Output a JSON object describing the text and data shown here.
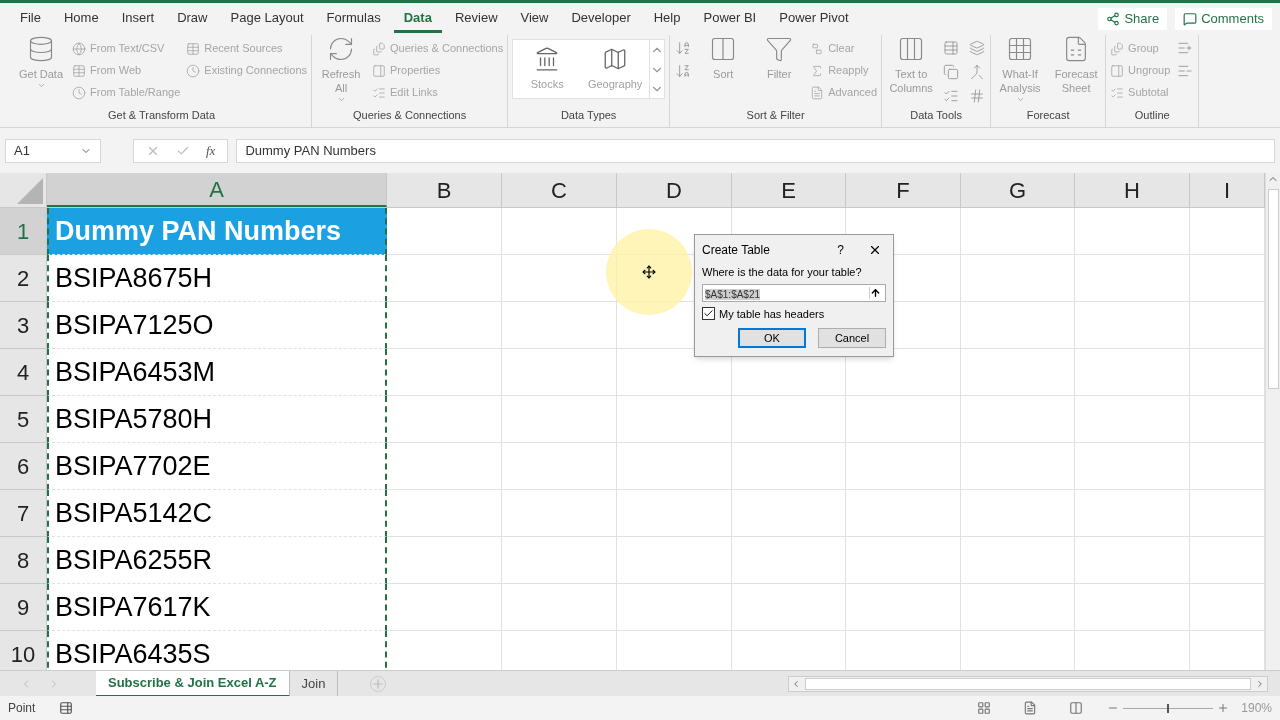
{
  "menu_tabs": [
    {
      "label": "File",
      "selected": false
    },
    {
      "label": "Home",
      "selected": false
    },
    {
      "label": "Insert",
      "selected": false
    },
    {
      "label": "Draw",
      "selected": false
    },
    {
      "label": "Page Layout",
      "selected": false
    },
    {
      "label": "Formulas",
      "selected": false
    },
    {
      "label": "Data",
      "selected": true
    },
    {
      "label": "Review",
      "selected": false
    },
    {
      "label": "View",
      "selected": false
    },
    {
      "label": "Developer",
      "selected": false
    },
    {
      "label": "Help",
      "selected": false
    },
    {
      "label": "Power BI",
      "selected": false
    },
    {
      "label": "Power Pivot",
      "selected": false
    }
  ],
  "share_button": "Share",
  "comments_button": "Comments",
  "ribbon_groups": [
    {
      "label": "Get & Transform Data",
      "items": [
        {
          "kind": "large",
          "label": "Get Data",
          "dropdown": true
        },
        {
          "kind": "stack",
          "labels": [
            "From Text/CSV",
            "From Web",
            "From Table/Range"
          ]
        },
        {
          "kind": "stack",
          "labels": [
            "Recent Sources",
            "Existing Connections"
          ]
        }
      ]
    },
    {
      "label": "Queries & Connections",
      "items": [
        {
          "kind": "large",
          "label": "Refresh All",
          "dropdown": true
        },
        {
          "kind": "stack",
          "labels": [
            "Queries & Connections",
            "Properties",
            "Edit Links"
          ]
        }
      ]
    },
    {
      "label": "Data Types",
      "items": [
        {
          "kind": "gallery",
          "labels": [
            "Stocks",
            "Geography"
          ]
        }
      ]
    },
    {
      "label": "Sort & Filter",
      "items": [
        {
          "kind": "sort_buttons"
        },
        {
          "kind": "large",
          "label": "Sort",
          "dropdown": false
        },
        {
          "kind": "large",
          "label": "Filter",
          "dropdown": false
        },
        {
          "kind": "stack",
          "labels": [
            "Clear",
            "Reapply",
            "Advanced"
          ]
        }
      ]
    },
    {
      "label": "Data Tools",
      "items": [
        {
          "kind": "large",
          "label": "Text to Columns",
          "dropdown": false
        },
        {
          "kind": "tool_grid"
        }
      ]
    },
    {
      "label": "Forecast",
      "items": [
        {
          "kind": "large",
          "label": "What-If Analysis",
          "dropdown": true
        },
        {
          "kind": "large",
          "label": "Forecast Sheet",
          "dropdown": false
        }
      ]
    },
    {
      "label": "Outline",
      "items": [
        {
          "kind": "stack",
          "labels": [
            "Group",
            "Ungroup",
            "Subtotal"
          ]
        },
        {
          "kind": "outline_buttons"
        }
      ]
    }
  ],
  "name_box": "A1",
  "fx_label": "fx",
  "formula": "Dummy PAN Numbers",
  "columns": [
    {
      "label": "A",
      "selected": true
    },
    {
      "label": "B",
      "selected": false
    },
    {
      "label": "C",
      "selected": false
    },
    {
      "label": "D",
      "selected": false
    },
    {
      "label": "E",
      "selected": false
    },
    {
      "label": "F",
      "selected": false
    },
    {
      "label": "G",
      "selected": false
    },
    {
      "label": "H",
      "selected": false
    },
    {
      "label": "I",
      "selected": false
    }
  ],
  "rows": [
    {
      "number": "1",
      "value": "Dummy PAN Numbers",
      "selected": true
    },
    {
      "number": "2",
      "value": "BSIPA8675H",
      "selected": false
    },
    {
      "number": "3",
      "value": "BSIPA7125O",
      "selected": false
    },
    {
      "number": "4",
      "value": "BSIPA6453M",
      "selected": false
    },
    {
      "number": "5",
      "value": "BSIPA5780H",
      "selected": false
    },
    {
      "number": "6",
      "value": "BSIPA7702E",
      "selected": false
    },
    {
      "number": "7",
      "value": "BSIPA5142C",
      "selected": false
    },
    {
      "number": "8",
      "value": "BSIPA6255R",
      "selected": false
    },
    {
      "number": "9",
      "value": "BSIPA7617K",
      "selected": false
    },
    {
      "number": "10",
      "value": "BSIPA6435S",
      "selected": false
    }
  ],
  "dialog": {
    "title": "Create Table",
    "help": "?",
    "prompt": "Where is the data for your table?",
    "range": "$A$1:$A$21",
    "checkbox": {
      "label": "My table has headers",
      "checked": true
    },
    "buttons": [
      "OK",
      "Cancel"
    ]
  },
  "sheet_tabs": [
    {
      "label": "Subscribe & Join Excel A-Z",
      "selected": true
    },
    {
      "label": "Join",
      "selected": false
    }
  ],
  "status_bar": {
    "mode": "Point",
    "zoom": "190%",
    "zoom_slider": {
      "level": 0.5
    }
  }
}
